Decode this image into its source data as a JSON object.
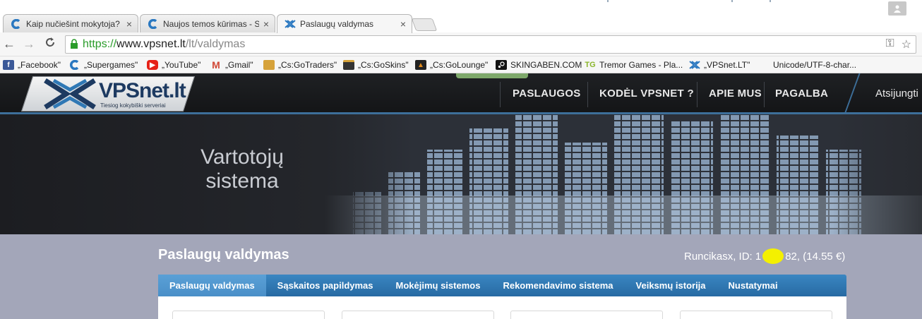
{
  "browser": {
    "tabs": [
      {
        "title": "Kaip nučiešint mokytoja? ",
        "icon": "blue-c-icon",
        "close": "×"
      },
      {
        "title": "Naujos temos kūrimas - S",
        "icon": "blue-c-icon",
        "close": "×"
      },
      {
        "title": "Paslaugų valdymas",
        "icon": "vpsnet-x-icon",
        "close": "×"
      }
    ],
    "nav": {
      "back": "←",
      "forward": "→",
      "reload": "C"
    },
    "url": {
      "scheme": "https://",
      "host": "www.vpsnet.lt",
      "path": "/lt/valdymas"
    },
    "omnibox_icons": {
      "key": "⚿",
      "star": "☆"
    },
    "bookmarks": [
      {
        "label": "„Facebook\"",
        "icon": "facebook-icon",
        "color": "#3b5998"
      },
      {
        "label": "„Supergames\"",
        "icon": "blue-c-icon",
        "color": "#2a78c0"
      },
      {
        "label": "„YouTube\"",
        "icon": "youtube-icon",
        "color": "#e62117"
      },
      {
        "label": "„Gmail\"",
        "icon": "gmail-icon",
        "color": "#d14836"
      },
      {
        "label": "„Cs:GoTraders\"",
        "icon": "csgotraders-icon",
        "color": "#d6a23a"
      },
      {
        "label": "„Cs:GoSkins\"",
        "icon": "csgoskins-icon",
        "color": "#333333"
      },
      {
        "label": "„Cs:GoLounge\"",
        "icon": "csgolounge-icon",
        "color": "#e08a1c"
      },
      {
        "label": "SKINGABEN.COM",
        "icon": "steam-icon",
        "color": "#111111"
      },
      {
        "label": "Tremor Games - Pla...",
        "icon": "tremor-games-icon",
        "color": "#8ab52a"
      },
      {
        "label": "„VPSnet.LT\"",
        "icon": "vpsnet-x-icon",
        "color": "#2a78c0"
      },
      {
        "label": "Unicode/UTF-8-char...",
        "icon": "blank-page-icon",
        "color": "#f6f6f6"
      }
    ]
  },
  "site": {
    "logo": {
      "text": "VPSnet.lt",
      "tagline": "Tiesiog kokybiški serveriai"
    },
    "nav": [
      "PASLAUGOS",
      "KODĖL VPSNET ?",
      "APIE MUS",
      "PAGALBA"
    ],
    "logout": "Atsijungti",
    "banner_title": "Vartotojų sistema"
  },
  "content": {
    "title": "Paslaugų valdymas",
    "user_prefix": "Runcikasx, ID: 1",
    "user_suffix": "82, (14.55 €)",
    "tabs": [
      "Paslaugų valdymas",
      "Sąskaitos papildymas",
      "Mokėjimų sistemos",
      "Rekomendavimo sistema",
      "Veiksmų istorija",
      "Nustatymai"
    ]
  },
  "colors": {
    "accent_blue": "#2f78b5",
    "secure_green": "#2a9c2a",
    "content_bg": "#a3a6b9",
    "redaction_yellow": "#f4f000",
    "header_dark": "#1a1b1e"
  }
}
